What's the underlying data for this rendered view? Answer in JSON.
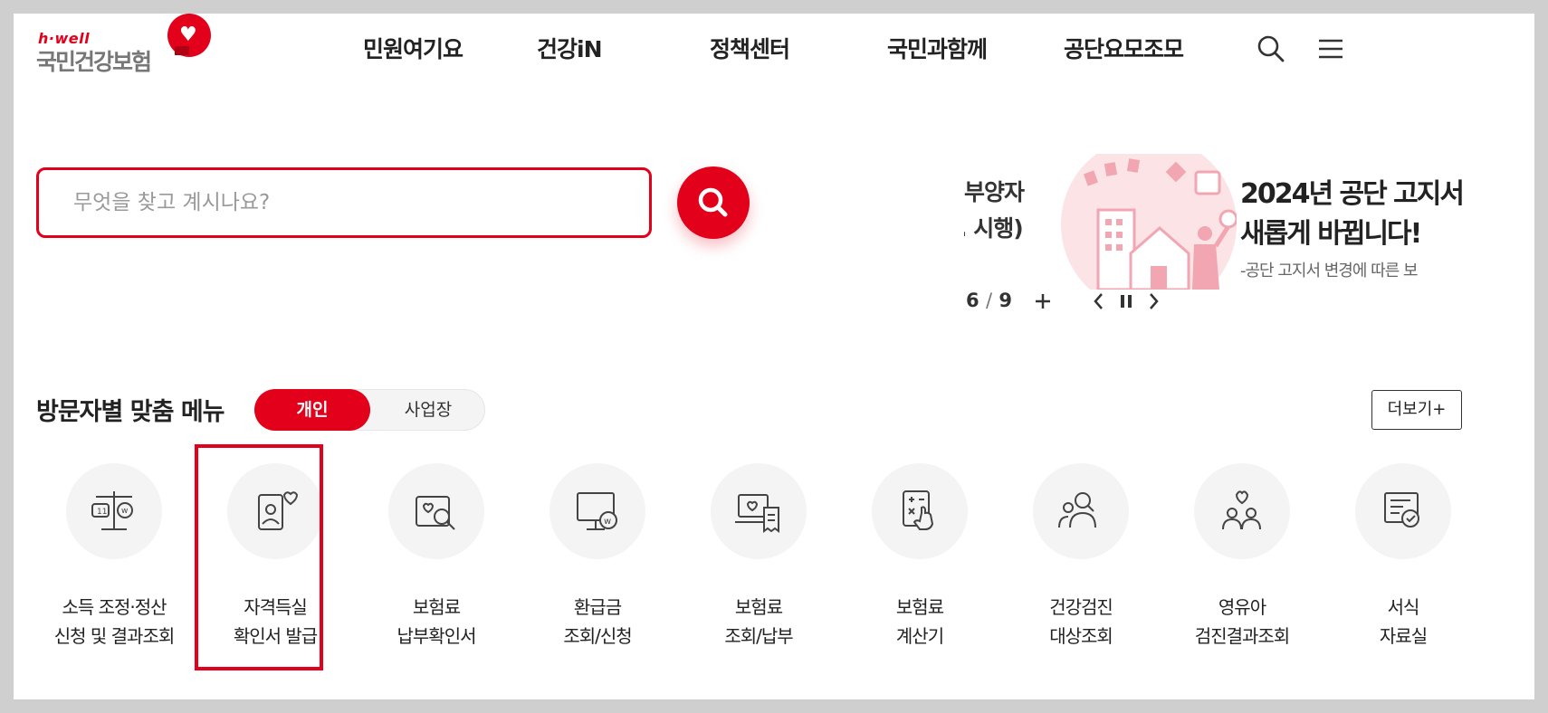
{
  "header": {
    "logo": {
      "sub": "h·well",
      "main": "국민건강보험"
    },
    "nav": [
      "민원여기요",
      "건강iN",
      "정책센터",
      "국민과함께",
      "공단요모조모"
    ],
    "icons": [
      "search-icon",
      "menu-icon"
    ]
  },
  "search": {
    "placeholder": "무엇을 찾고 계시나요?",
    "value": "",
    "button_icon": "search-icon"
  },
  "banner": {
    "prev_text_1": "부양자",
    "prev_text_2": ". 시행)",
    "title_1": "2024년 공단 고지서",
    "title_2": "새롭게 바뀝니다!",
    "description": "-공단 고지서 변경에 따른 보",
    "current": "6",
    "separator": "/",
    "total": "9",
    "controls": [
      "plus-icon",
      "chevron-left-icon",
      "pause-icon",
      "chevron-right-icon"
    ]
  },
  "visitor_menu": {
    "title": "방문자별 맞춤 메뉴",
    "tabs": [
      {
        "label": "개인",
        "active": true
      },
      {
        "label": "사업장",
        "active": false
      }
    ],
    "more_label": "더보기+",
    "items": [
      {
        "line1": "소득 조정·정산",
        "line2": "신청 및 결과조회",
        "icon": "scale-icon"
      },
      {
        "line1": "자격득실",
        "line2": "확인서 발급",
        "icon": "id-card-heart-icon",
        "highlighted": true
      },
      {
        "line1": "보험료",
        "line2": "납부확인서",
        "icon": "document-search-icon"
      },
      {
        "line1": "환급금",
        "line2": "조회/신청",
        "icon": "monitor-won-icon"
      },
      {
        "line1": "보험료",
        "line2": "조회/납부",
        "icon": "laptop-receipt-icon"
      },
      {
        "line1": "보험료",
        "line2": "계산기",
        "icon": "calculator-hand-icon"
      },
      {
        "line1": "건강검진",
        "line2": "대상조회",
        "icon": "people-search-icon"
      },
      {
        "line1": "영유아",
        "line2": "검진결과조회",
        "icon": "family-heart-icon"
      },
      {
        "line1": "서식",
        "line2": "자료실",
        "icon": "form-check-icon"
      }
    ]
  },
  "colors": {
    "brand_red": "#e3001b",
    "text_dark": "#222222",
    "icon_bg": "#f4f4f4",
    "outer_frame": "#cfcfcf"
  }
}
